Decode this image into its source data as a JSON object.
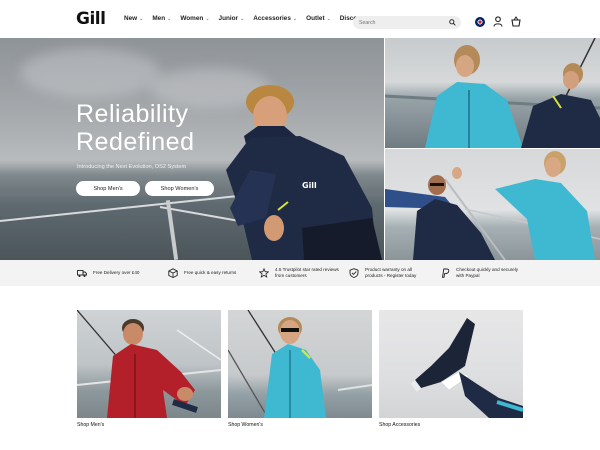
{
  "brand": {
    "logo_text": "Gill"
  },
  "nav": {
    "items": [
      {
        "label": "New"
      },
      {
        "label": "Men"
      },
      {
        "label": "Women"
      },
      {
        "label": "Junior"
      },
      {
        "label": "Accessories"
      },
      {
        "label": "Outlet"
      },
      {
        "label": "Discover"
      }
    ]
  },
  "search": {
    "placeholder": "Search"
  },
  "hero": {
    "title_line1": "Reliability",
    "title_line2": "Redefined",
    "subtitle": "Introducing the Next Evolution, OS2 System",
    "button_men": "Shop Men's",
    "button_women": "Shop Women's"
  },
  "benefits": [
    {
      "icon": "truck-icon",
      "text": "Free Delivery over £40"
    },
    {
      "icon": "box-icon",
      "text": "Free quick & easy returns"
    },
    {
      "icon": "star-icon",
      "line1": "4.5 Trustpilot star rated reviews",
      "line2": "from customers"
    },
    {
      "icon": "shield-check-icon",
      "line1": "Product warranty on all",
      "line2": "products - Register today"
    },
    {
      "icon": "paypal-icon",
      "line1": "Checkout quickly and securely",
      "line2": "with Paypal"
    }
  ],
  "tiles": [
    {
      "label": "Shop Men's"
    },
    {
      "label": "Shop Women's"
    },
    {
      "label": "Shop Accessories"
    }
  ],
  "colors": {
    "navy_jacket": "#1f2a44",
    "teal_jacket": "#3fb8d2",
    "red_jacket": "#b3202a",
    "hivis_yellow": "#d8e43a"
  }
}
